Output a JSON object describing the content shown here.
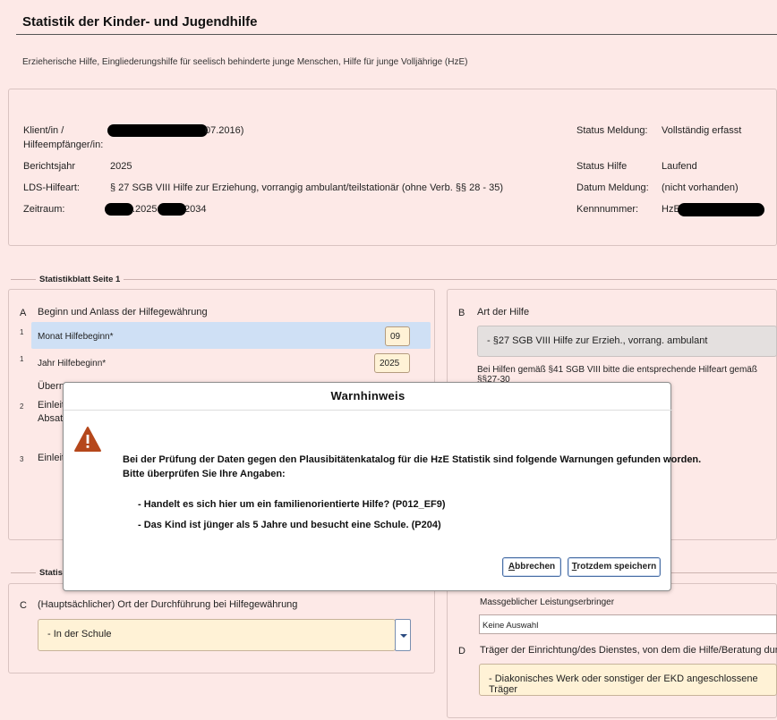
{
  "header": {
    "title": "Statistik der Kinder- und Jugendhilfe",
    "subtitle": "Erzieherische Hilfe, Eingliederungshilfe für seelisch behinderte junge Menschen, Hilfe für junge Volljährige (HzE)"
  },
  "info": {
    "client_label": "Klient/in /",
    "client_label_2": "Hilfeempfänger/in:",
    "client_value_tail": "07.2016)",
    "berichtsjahr_label": "Berichtsjahr",
    "berichtsjahr_value": "2025",
    "lds_label": "LDS-Hilfeart:",
    "lds_value": "§ 27 SGB VIII Hilfe zur Erziehung, vorrangig ambulant/teilstationär (ohne Verb. §§ 28 - 35)",
    "zeitraum_label": "Zeitraum:",
    "zeitraum_mid": ".2025 -",
    "zeitraum_tail": "2034",
    "status_meldung_label": "Status Meldung:",
    "status_meldung_value": "Vollständig erfasst",
    "status_hilfe_label": "Status Hilfe",
    "status_hilfe_value": "Laufend",
    "datum_label": "Datum Meldung:",
    "datum_value": "(nicht vorhanden)",
    "kennnummer_label": "Kennnummer:",
    "kennnummer_prefix": "HzE"
  },
  "blatt1": {
    "legend": "Statistikblatt Seite 1",
    "sectionA": {
      "letter": "A",
      "title": "Beginn und Anlass der Hilfegewährung",
      "row1_num": "1",
      "monat_label": "Monat Hilfebeginn*",
      "monat_value": "09",
      "row2_num": "1",
      "jahr_label": "Jahr Hilfebeginn*",
      "jahr_value": "2025",
      "uebern_partial": "Übern",
      "row3_num": "2",
      "einleit_partial": "Einleit",
      "absatz_partial": "Absatz",
      "row4_num": "3",
      "einleit2_partial": "Einleit"
    },
    "sectionB": {
      "letter": "B",
      "title": "Art der Hilfe",
      "art_value": "-   §27 SGB VIII Hilfe zur Erzieh., vorrang. ambulant",
      "hint": "Bei Hilfen gemäß §41 SGB VIII bitte die entsprechende Hilfeart gemäß §§27-30"
    }
  },
  "blatt2": {
    "legend_partial": "Statist",
    "sectionC": {
      "letter": "C",
      "title": "(Hauptsächlicher) Ort der Durchführung bei Hilfegewährung",
      "select_value": "-   In der Schule"
    },
    "leistung_label": "Massgeblicher Leistungserbringer",
    "leistung_value": "Keine Auswahl",
    "sectionD": {
      "letter": "D",
      "title": "Träger der Einrichtung/des Dienstes, von dem die Hilfe/Beratung durchgef",
      "value": "-   Diakonisches Werk oder sonstiger der EKD angeschlossene Träger"
    }
  },
  "modal": {
    "title": "Warnhinweis",
    "icon": "warning-icon",
    "line1": "Bei der Prüfung der Daten gegen den Plausibitätenkatalog für die HzE Statistik sind folgende Warnungen gefunden worden.",
    "line2": "Bitte überprüfen Sie Ihre Angaben:",
    "warnings": [
      "-   Handelt es sich hier um ein familienorientierte Hilfe?  (P012_EF9)",
      "-   Das Kind ist jünger als 5 Jahre und besucht eine Schule.  (P204)"
    ],
    "cancel_u": "A",
    "cancel_rest": "bbrechen",
    "save_u": "T",
    "save_rest": "rotzdem speichern"
  },
  "colors": {
    "background": "#fde9e7",
    "highlight": "#cfe0f5",
    "field": "#fff2d6",
    "warning": "#b5471b"
  }
}
